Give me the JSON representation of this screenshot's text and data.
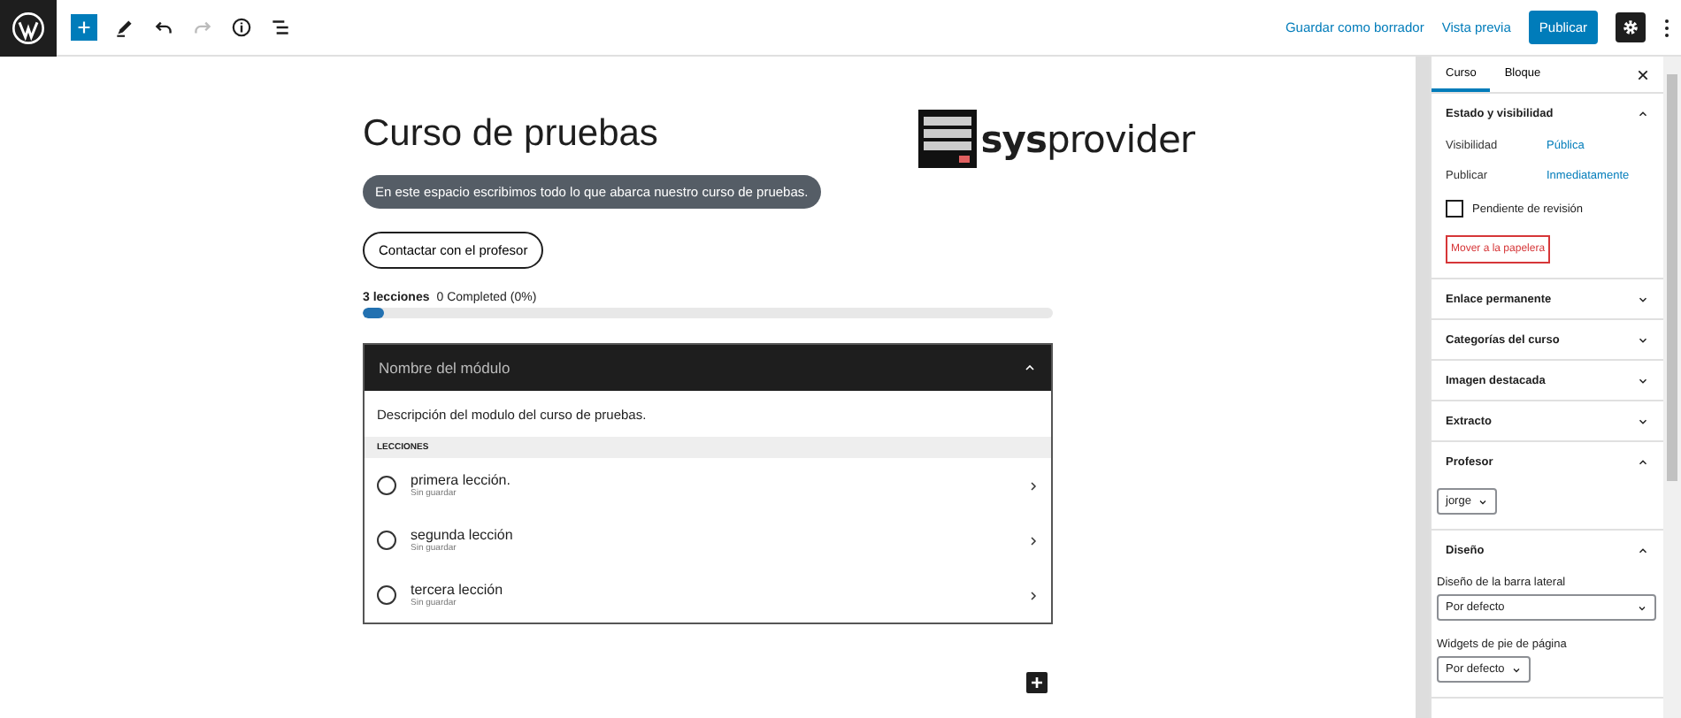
{
  "toolbar": {
    "tools": [
      {
        "kind": "add",
        "disabled": false
      },
      {
        "kind": "edit",
        "disabled": false
      },
      {
        "kind": "undo",
        "disabled": false
      },
      {
        "kind": "redo",
        "disabled": true
      },
      {
        "kind": "info",
        "disabled": false
      },
      {
        "kind": "outline",
        "disabled": false
      }
    ],
    "actions": [
      {
        "kind": "link",
        "label": "Guardar como borrador"
      },
      {
        "kind": "link",
        "label": "Vista previa"
      },
      {
        "kind": "primary",
        "label": "Publicar"
      }
    ]
  },
  "post": {
    "title": "Curso de pruebas",
    "logo": "**sys**provider",
    "description": "En este espacio escribimos todo lo que abarca nuestro curso de pruebas.",
    "contact_button": "Contactar con el profesor",
    "progress": {
      "lessons": "3 lecciones",
      "completed": "0 Completed (0%)",
      "level": 0.03
    },
    "module": {
      "title": "Nombre del módulo",
      "expanded": true,
      "description": "Descripción del modulo del curso de pruebas.",
      "lessons_heading": "LECCIONES",
      "lessons": [
        {
          "title": "primera lección.",
          "status": "Sin guardar",
          "completed": false
        },
        {
          "title": "segunda lección",
          "status": "Sin guardar",
          "completed": false
        },
        {
          "title": "tercera lección",
          "status": "Sin guardar",
          "completed": false
        }
      ]
    }
  },
  "sidebar": {
    "tabs": [
      {
        "label": "Curso",
        "selected": true
      },
      {
        "label": "Bloque",
        "selected": false
      }
    ],
    "panels": [
      {
        "title": "Estado y visibilidad",
        "expanded": true,
        "items": [
          {
            "kind": "row",
            "label": "Visibilidad",
            "value": "Pública"
          },
          {
            "kind": "row",
            "label": "Publicar",
            "value": "Inmediatamente"
          },
          {
            "kind": "checkbox",
            "label": "Pendiente de revisión",
            "checked": false
          },
          {
            "kind": "danger",
            "label": "Mover a la papelera"
          }
        ]
      },
      {
        "title": "Enlace permanente",
        "expanded": false
      },
      {
        "title": "Categorías del curso",
        "expanded": false
      },
      {
        "title": "Imagen destacada",
        "expanded": false
      },
      {
        "title": "Extracto",
        "expanded": false
      },
      {
        "title": "Profesor",
        "expanded": true,
        "items": [
          {
            "kind": "select",
            "value": "jorge",
            "wide": false
          }
        ]
      },
      {
        "title": "Diseño",
        "expanded": true,
        "items": [
          {
            "kind": "select",
            "label": "Diseño de la barra lateral",
            "value": "Por defecto",
            "wide": true
          },
          {
            "kind": "select",
            "label": "Widgets de pie de página",
            "value": "Por defecto",
            "wide": false
          }
        ]
      }
    ]
  }
}
